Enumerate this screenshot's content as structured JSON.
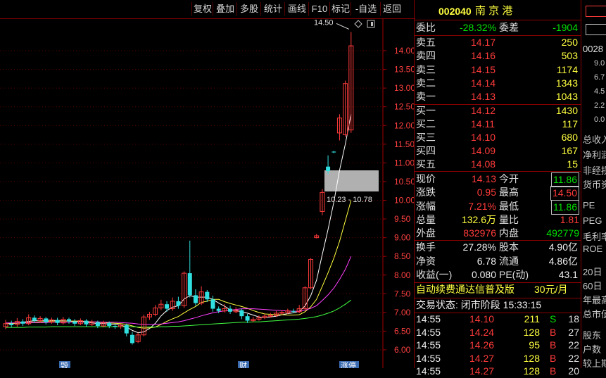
{
  "toolbar": {
    "items": [
      "复权",
      "叠加",
      "多股",
      "统计",
      "画线",
      "F10",
      "标记",
      "-自选",
      "返回"
    ]
  },
  "chart": {
    "y_ticks": [
      "14.00",
      "13.50",
      "13.00",
      "12.50",
      "12.00",
      "11.50",
      "11.00",
      "10.50",
      "10.00",
      "9.50",
      "9.00",
      "8.50",
      "8.00",
      "7.50",
      "7.00",
      "6.50",
      "6.00"
    ],
    "high_marker": "14.50",
    "range_label": "10.23 - 10.78",
    "bottom_marks": [
      "毁",
      "财",
      "涨停"
    ]
  },
  "chart_data": {
    "type": "candlestick",
    "ylim": [
      5.8,
      14.8
    ],
    "y_ticks": [
      14.0,
      13.5,
      13.0,
      12.5,
      12.0,
      11.5,
      11.0,
      10.5,
      10.0,
      9.5,
      9.0,
      8.5,
      8.0,
      7.5,
      7.0,
      6.5,
      6.0
    ],
    "candles": [
      {
        "o": 6.62,
        "c": 6.7,
        "h": 6.8,
        "l": 6.55
      },
      {
        "o": 6.7,
        "c": 6.66,
        "h": 6.78,
        "l": 6.6
      },
      {
        "o": 6.68,
        "c": 6.76,
        "h": 6.85,
        "l": 6.62
      },
      {
        "o": 6.76,
        "c": 6.7,
        "h": 6.82,
        "l": 6.64
      },
      {
        "o": 6.7,
        "c": 6.86,
        "h": 6.95,
        "l": 6.66
      },
      {
        "o": 6.86,
        "c": 6.78,
        "h": 6.92,
        "l": 6.72
      },
      {
        "o": 6.78,
        "c": 6.84,
        "h": 6.9,
        "l": 6.72
      },
      {
        "o": 6.84,
        "c": 6.74,
        "h": 6.88,
        "l": 6.68
      },
      {
        "o": 6.74,
        "c": 6.8,
        "h": 6.86,
        "l": 6.7
      },
      {
        "o": 6.8,
        "c": 6.72,
        "h": 6.86,
        "l": 6.66
      },
      {
        "o": 6.72,
        "c": 6.82,
        "h": 6.88,
        "l": 6.68
      },
      {
        "o": 6.82,
        "c": 6.76,
        "h": 6.86,
        "l": 6.7
      },
      {
        "o": 6.76,
        "c": 6.7,
        "h": 6.82,
        "l": 6.64
      },
      {
        "o": 6.7,
        "c": 6.78,
        "h": 6.84,
        "l": 6.66
      },
      {
        "o": 6.78,
        "c": 6.68,
        "h": 6.82,
        "l": 6.62
      },
      {
        "o": 6.68,
        "c": 6.74,
        "h": 6.8,
        "l": 6.64
      },
      {
        "o": 6.74,
        "c": 6.64,
        "h": 6.78,
        "l": 6.58
      },
      {
        "o": 6.64,
        "c": 6.72,
        "h": 6.78,
        "l": 6.6
      },
      {
        "o": 6.72,
        "c": 6.64,
        "h": 6.76,
        "l": 6.58
      },
      {
        "o": 6.64,
        "c": 6.62,
        "h": 6.7,
        "l": 6.56
      },
      {
        "o": 6.62,
        "c": 6.66,
        "h": 6.7,
        "l": 6.56
      },
      {
        "o": 6.66,
        "c": 6.44,
        "h": 6.7,
        "l": 6.36
      },
      {
        "o": 6.4,
        "c": 6.18,
        "h": 6.48,
        "l": 6.14
      },
      {
        "o": 6.22,
        "c": 6.4,
        "h": 6.46,
        "l": 6.18
      },
      {
        "o": 6.4,
        "c": 6.88,
        "h": 6.94,
        "l": 6.36
      },
      {
        "o": 6.88,
        "c": 6.95,
        "h": 7.02,
        "l": 6.8
      },
      {
        "o": 6.95,
        "c": 7.12,
        "h": 7.2,
        "l": 6.9
      },
      {
        "o": 7.12,
        "c": 7.22,
        "h": 7.34,
        "l": 7.06
      },
      {
        "o": 7.22,
        "c": 7.1,
        "h": 7.3,
        "l": 7.02
      },
      {
        "o": 7.1,
        "c": 7.3,
        "h": 7.4,
        "l": 7.04
      },
      {
        "o": 7.3,
        "c": 7.18,
        "h": 7.42,
        "l": 7.1
      },
      {
        "o": 7.18,
        "c": 8.05,
        "h": 8.1,
        "l": 7.12
      },
      {
        "o": 8.05,
        "c": 7.46,
        "h": 8.92,
        "l": 7.4
      },
      {
        "o": 7.46,
        "c": 7.25,
        "h": 7.62,
        "l": 7.18
      },
      {
        "o": 7.25,
        "c": 7.55,
        "h": 7.7,
        "l": 7.2
      },
      {
        "o": 7.55,
        "c": 7.35,
        "h": 7.6,
        "l": 7.28
      },
      {
        "o": 7.35,
        "c": 7.1,
        "h": 7.45,
        "l": 7.02
      },
      {
        "o": 7.1,
        "c": 7.04,
        "h": 7.16,
        "l": 6.98
      },
      {
        "o": 7.04,
        "c": 7.1,
        "h": 7.22,
        "l": 7.0
      },
      {
        "o": 7.1,
        "c": 7.02,
        "h": 7.18,
        "l": 6.96
      },
      {
        "o": 7.02,
        "c": 7.06,
        "h": 7.14,
        "l": 6.98
      },
      {
        "o": 7.06,
        "c": 6.9,
        "h": 7.1,
        "l": 6.82
      },
      {
        "o": 6.9,
        "c": 6.78,
        "h": 6.96,
        "l": 6.72
      },
      {
        "o": 6.78,
        "c": 6.82,
        "h": 6.88,
        "l": 6.74
      },
      {
        "o": 6.82,
        "c": 6.86,
        "h": 6.92,
        "l": 6.78
      },
      {
        "o": 6.86,
        "c": 6.9,
        "h": 6.96,
        "l": 6.82
      },
      {
        "o": 6.9,
        "c": 6.92,
        "h": 6.98,
        "l": 6.86
      },
      {
        "o": 6.92,
        "c": 6.98,
        "h": 7.04,
        "l": 6.88
      },
      {
        "o": 6.98,
        "c": 7.0,
        "h": 7.06,
        "l": 6.94
      },
      {
        "o": 7.0,
        "c": 7.04,
        "h": 7.1,
        "l": 6.96
      },
      {
        "o": 7.04,
        "c": 7.02,
        "h": 7.1,
        "l": 6.98
      },
      {
        "o": 7.02,
        "c": 7.1,
        "h": 7.2,
        "l": 6.98
      },
      {
        "o": 7.1,
        "c": 7.66,
        "h": 7.7,
        "l": 7.06
      },
      {
        "o": 7.66,
        "c": 8.42,
        "h": 8.45,
        "l": 7.62
      },
      {
        "o": 9.0,
        "c": 9.05,
        "h": 9.1,
        "l": 8.98
      },
      {
        "o": 9.7,
        "c": 10.21,
        "h": 10.3,
        "l": 9.6
      },
      {
        "o": 10.9,
        "c": 10.78,
        "h": 11.2,
        "l": 10.7
      },
      {
        "o": 11.3,
        "c": 11.28,
        "h": 11.32,
        "l": 11.26
      },
      {
        "o": 11.8,
        "c": 12.2,
        "h": 12.3,
        "l": 11.6
      },
      {
        "o": 11.75,
        "c": 13.12,
        "h": 13.2,
        "l": 11.7
      },
      {
        "o": 11.88,
        "c": 14.13,
        "h": 14.5,
        "l": 11.8
      }
    ],
    "ma": [
      {
        "name": "MA5",
        "color": "#ffffff",
        "values": [
          6.7,
          6.71,
          6.72,
          6.74,
          6.76,
          6.78,
          6.78,
          6.79,
          6.79,
          6.78,
          6.78,
          6.77,
          6.76,
          6.75,
          6.74,
          6.72,
          6.7,
          6.7,
          6.69,
          6.68,
          6.66,
          6.61,
          6.52,
          6.46,
          6.48,
          6.57,
          6.71,
          6.91,
          7.05,
          7.14,
          7.18,
          7.36,
          7.45,
          7.41,
          7.41,
          7.41,
          7.35,
          7.25,
          7.17,
          7.07,
          7.05,
          7.02,
          6.98,
          6.93,
          6.88,
          6.86,
          6.88,
          6.9,
          6.94,
          6.97,
          6.99,
          7.03,
          7.17,
          7.45,
          7.86,
          8.55,
          9.22,
          9.95,
          10.8,
          11.5,
          12.3
        ]
      },
      {
        "name": "MA10",
        "color": "#ffff40",
        "values": [
          6.7,
          6.7,
          6.71,
          6.72,
          6.73,
          6.74,
          6.75,
          6.76,
          6.77,
          6.77,
          6.77,
          6.77,
          6.77,
          6.77,
          6.76,
          6.75,
          6.74,
          6.73,
          6.72,
          6.71,
          6.7,
          6.68,
          6.64,
          6.6,
          6.58,
          6.59,
          6.61,
          6.68,
          6.76,
          6.83,
          6.89,
          6.99,
          7.08,
          7.16,
          7.27,
          7.3,
          7.35,
          7.35,
          7.29,
          7.24,
          7.2,
          7.16,
          7.11,
          7.05,
          7.0,
          6.96,
          6.95,
          6.94,
          6.94,
          6.93,
          6.93,
          6.94,
          7.02,
          7.15,
          7.35,
          7.7,
          8.06,
          8.45,
          8.9,
          9.45,
          10.0
        ]
      },
      {
        "name": "MA20",
        "color": "#ff40ff",
        "values": [
          6.72,
          6.72,
          6.72,
          6.72,
          6.72,
          6.73,
          6.73,
          6.73,
          6.74,
          6.74,
          6.74,
          6.74,
          6.75,
          6.75,
          6.75,
          6.75,
          6.75,
          6.74,
          6.74,
          6.74,
          6.73,
          6.72,
          6.71,
          6.69,
          6.68,
          6.68,
          6.68,
          6.69,
          6.71,
          6.73,
          6.75,
          6.78,
          6.82,
          6.86,
          6.91,
          6.95,
          6.99,
          7.02,
          7.04,
          7.06,
          7.08,
          7.1,
          7.1,
          7.1,
          7.09,
          7.08,
          7.07,
          7.06,
          7.05,
          7.04,
          7.03,
          7.03,
          7.06,
          7.11,
          7.18,
          7.32,
          7.47,
          7.65,
          7.88,
          8.15,
          8.5
        ]
      },
      {
        "name": "MA60",
        "color": "#40ff40",
        "values": [
          6.6,
          6.6,
          6.6,
          6.6,
          6.61,
          6.61,
          6.61,
          6.61,
          6.62,
          6.62,
          6.62,
          6.62,
          6.62,
          6.62,
          6.62,
          6.62,
          6.62,
          6.62,
          6.62,
          6.62,
          6.62,
          6.62,
          6.62,
          6.61,
          6.61,
          6.61,
          6.61,
          6.62,
          6.62,
          6.63,
          6.63,
          6.64,
          6.65,
          6.66,
          6.67,
          6.68,
          6.69,
          6.7,
          6.71,
          6.72,
          6.73,
          6.74,
          6.74,
          6.75,
          6.75,
          6.76,
          6.77,
          6.78,
          6.79,
          6.8,
          6.81,
          6.82,
          6.84,
          6.86,
          6.89,
          6.93,
          6.98,
          7.04,
          7.12,
          7.22,
          7.33
        ]
      }
    ]
  },
  "quote": {
    "code": "002040",
    "name": "南 京 港",
    "weibi_label": "委比",
    "weibi_value": "-28.32%",
    "weicha_label": "委差",
    "weicha_value": "-1904",
    "asks": [
      {
        "label": "卖五",
        "price": "14.17",
        "vol": "250"
      },
      {
        "label": "卖四",
        "price": "14.16",
        "vol": "503"
      },
      {
        "label": "卖三",
        "price": "14.15",
        "vol": "1174"
      },
      {
        "label": "卖二",
        "price": "14.14",
        "vol": "1343"
      },
      {
        "label": "卖一",
        "price": "14.13",
        "vol": "1043"
      }
    ],
    "bids": [
      {
        "label": "买一",
        "price": "14.12",
        "vol": "1430"
      },
      {
        "label": "买二",
        "price": "14.11",
        "vol": "117"
      },
      {
        "label": "买三",
        "price": "14.10",
        "vol": "680"
      },
      {
        "label": "买四",
        "price": "14.09",
        "vol": "167"
      },
      {
        "label": "买五",
        "price": "14.08",
        "vol": "15"
      }
    ],
    "stats": [
      {
        "l1": "现价",
        "v1": "14.13",
        "l2": "今开",
        "v2": "11.86",
        "c1": "red",
        "c2": "green",
        "box2": true
      },
      {
        "l1": "涨跌",
        "v1": "0.95",
        "l2": "最高",
        "v2": "14.50",
        "c1": "red",
        "c2": "red",
        "box2": true
      },
      {
        "l1": "涨幅",
        "v1": "7.21%",
        "l2": "最低",
        "v2": "11.86",
        "c1": "red",
        "c2": "green",
        "box2": true
      },
      {
        "l1": "总量",
        "v1": "132.6万",
        "l2": "量比",
        "v2": "1.81",
        "c1": "yellow",
        "c2": "red",
        "box2": false
      },
      {
        "l1": "外盘",
        "v1": "832976",
        "l2": "内盘",
        "v2": "492779",
        "c1": "red",
        "c2": "green",
        "box2": false
      }
    ],
    "fin": [
      {
        "l1": "换手",
        "v1": "27.28%",
        "l2": "股本",
        "v2": "4.90亿"
      },
      {
        "l1": "净资",
        "v1": "6.78",
        "l2": "流通",
        "v2": "4.86亿"
      },
      {
        "l1": "收益(一)",
        "v1": "0.080",
        "l2": "PE(动)",
        "v2": "43.1"
      }
    ],
    "promo": "自动续费通达信普及版",
    "promo_price": "30元/月",
    "status": "交易状态: 闭市阶段 15:33:15",
    "ticks": [
      {
        "time": "14:55",
        "price": "14.10",
        "vol": "211",
        "bs": "S",
        "n": "18"
      },
      {
        "time": "14:55",
        "price": "14.24",
        "vol": "128",
        "bs": "B",
        "n": "27"
      },
      {
        "time": "14:55",
        "price": "14.26",
        "vol": "95",
        "bs": "B",
        "n": "22"
      },
      {
        "time": "14:55",
        "price": "14.27",
        "vol": "128",
        "bs": "B",
        "n": "22"
      },
      {
        "time": "14:55",
        "price": "14.27",
        "vol": "128",
        "bs": "B",
        "n": "20"
      }
    ]
  },
  "side": {
    "code": "0028",
    "nums": [
      "9.0",
      "6.7",
      "4.5",
      "2.2",
      "0.0"
    ],
    "labels": [
      "总收入",
      "净利润",
      "非经损",
      "货币资",
      "PE",
      "PEG",
      "毛利率",
      "ROE",
      "20日",
      "60日",
      "年最高",
      "总市值",
      "股东",
      "户数",
      "较上期"
    ]
  }
}
